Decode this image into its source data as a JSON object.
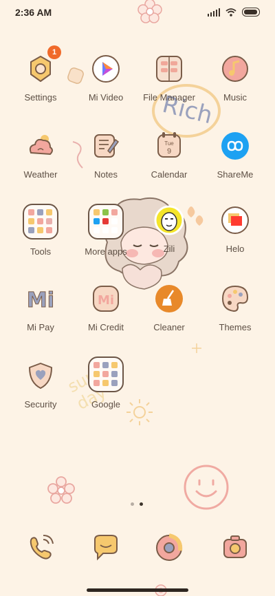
{
  "status": {
    "time": "2:36 AM"
  },
  "apps": [
    {
      "id": "settings",
      "label": "Settings",
      "badge": "1"
    },
    {
      "id": "mi-video",
      "label": "Mi Video"
    },
    {
      "id": "file-manager",
      "label": "File Manager"
    },
    {
      "id": "music",
      "label": "Music"
    },
    {
      "id": "weather",
      "label": "Weather"
    },
    {
      "id": "notes",
      "label": "Notes"
    },
    {
      "id": "calendar",
      "label": "Calendar",
      "icon_text": "Tue 9"
    },
    {
      "id": "shareme",
      "label": "ShareMe"
    },
    {
      "id": "tools",
      "label": "Tools"
    },
    {
      "id": "more-apps",
      "label": "More apps"
    },
    {
      "id": "zili",
      "label": "Zili"
    },
    {
      "id": "helo",
      "label": "Helo"
    },
    {
      "id": "mi-pay",
      "label": "Mi Pay",
      "icon_text": "Mi"
    },
    {
      "id": "mi-credit",
      "label": "Mi Credit",
      "icon_text": "Mi"
    },
    {
      "id": "cleaner",
      "label": "Cleaner"
    },
    {
      "id": "themes",
      "label": "Themes"
    },
    {
      "id": "security",
      "label": "Security"
    },
    {
      "id": "google",
      "label": "Google"
    }
  ],
  "wallpaper": {
    "text_rich": "Rich",
    "text_sunny": "sunny day"
  },
  "dock": [
    {
      "id": "phone",
      "icon": "phone-icon"
    },
    {
      "id": "messages",
      "icon": "chat-bubble-icon"
    },
    {
      "id": "browser",
      "icon": "browser-icon"
    },
    {
      "id": "camera",
      "icon": "camera-icon"
    }
  ],
  "page_indicator": {
    "total": 2,
    "current": 2
  }
}
